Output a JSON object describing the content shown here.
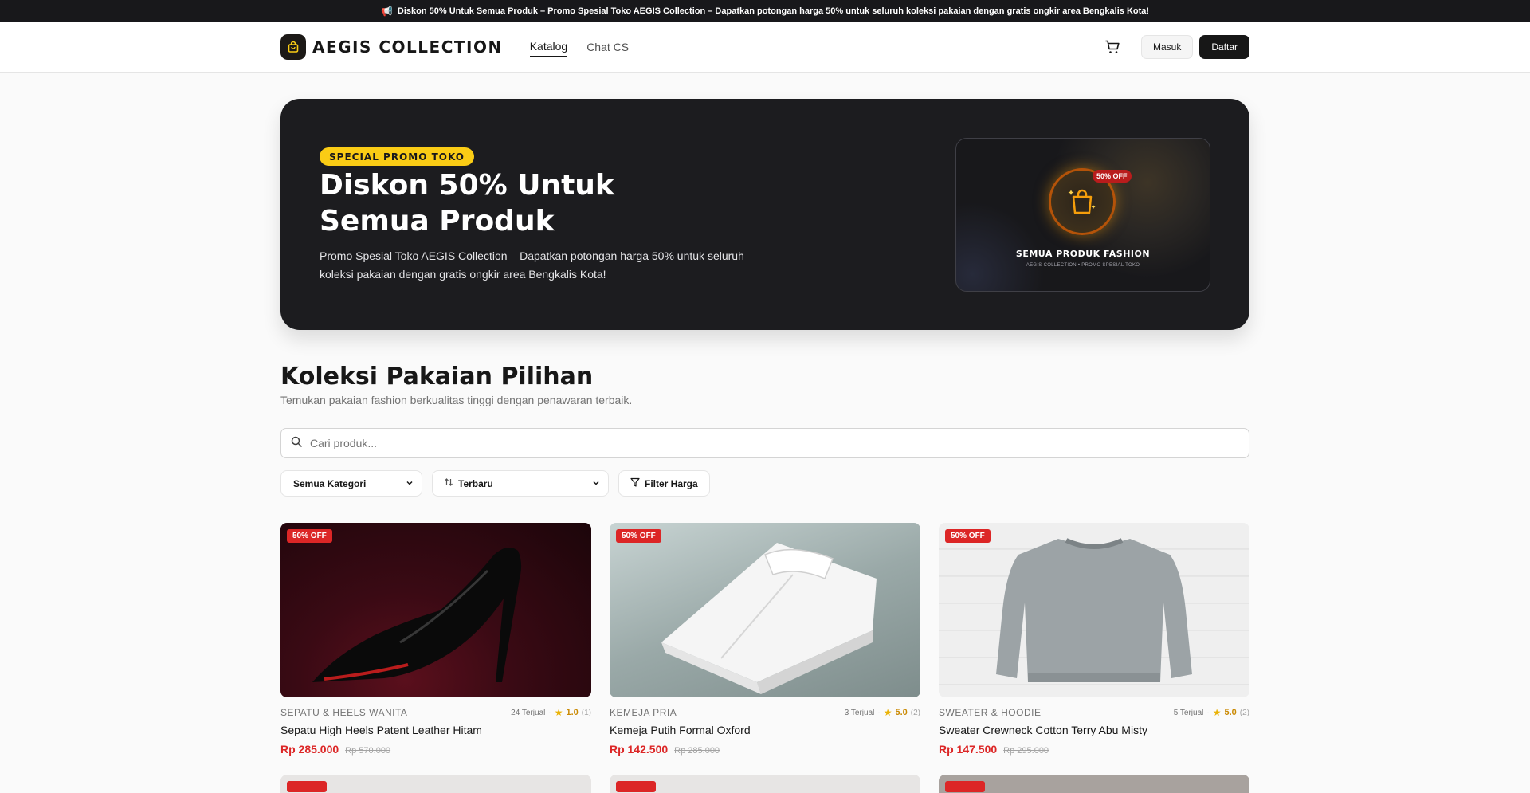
{
  "announcement": {
    "icon": "megaphone-icon",
    "text": "Diskon 50% Untuk Semua Produk – Promo Spesial Toko AEGIS Collection – Dapatkan potongan harga 50% untuk seluruh koleksi pakaian dengan gratis ongkir area Bengkalis Kota!"
  },
  "header": {
    "brand": "AEGIS COLLECTION",
    "nav": [
      {
        "label": "Katalog",
        "active": true
      },
      {
        "label": "Chat CS",
        "active": false
      }
    ],
    "login_label": "Masuk",
    "register_label": "Daftar"
  },
  "hero": {
    "badge": "SPECIAL PROMO TOKO",
    "title": "Diskon 50% Untuk Semua Produk",
    "description": "Promo Spesial Toko AEGIS Collection – Dapatkan potongan harga 50% untuk seluruh koleksi pakaian dengan gratis ongkir area Bengkalis Kota!",
    "card": {
      "discount": "50% OFF",
      "title": "SEMUA PRODUK FASHION",
      "subtitle": "AEGIS COLLECTION • PROMO SPESIAL TOKO"
    }
  },
  "section": {
    "title": "Koleksi Pakaian Pilihan",
    "subtitle": "Temukan pakaian fashion berkualitas tinggi dengan penawaran terbaik."
  },
  "search": {
    "placeholder": "Cari produk...",
    "value": ""
  },
  "filters": {
    "category": "Semua Kategori",
    "sort": "Terbaru",
    "price_filter": "Filter Harga"
  },
  "products": [
    {
      "discount": "50% OFF",
      "category": "SEPATU & HEELS WANITA",
      "sold": "24 Terjual",
      "rating": "1.0",
      "reviews": "(1)",
      "name": "Sepatu High Heels Patent Leather Hitam",
      "price": "Rp 285.000",
      "old_price": "Rp 570.000"
    },
    {
      "discount": "50% OFF",
      "category": "KEMEJA PRIA",
      "sold": "3 Terjual",
      "rating": "5.0",
      "reviews": "(2)",
      "name": "Kemeja Putih Formal Oxford",
      "price": "Rp 142.500",
      "old_price": "Rp 285.000"
    },
    {
      "discount": "50% OFF",
      "category": "SWEATER & HOODIE",
      "sold": "5 Terjual",
      "rating": "5.0",
      "reviews": "(2)",
      "name": "Sweater Crewneck Cotton Terry Abu Misty",
      "price": "Rp 147.500",
      "old_price": "Rp 295.000"
    }
  ]
}
